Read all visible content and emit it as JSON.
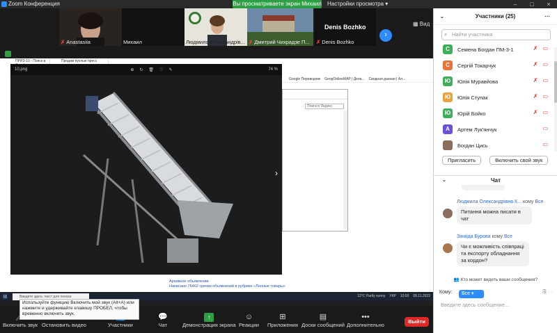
{
  "window": {
    "title": "Zoom Конференция",
    "viewing_banner": "Вы просматриваете экран Михаил",
    "view_options": "Настройки просмотра ▾"
  },
  "video_tiles": [
    {
      "name": "Anastasiia",
      "muted": true
    },
    {
      "name": "Михаил",
      "muted": false
    },
    {
      "name": "Людмила Олександрів...",
      "muted": false
    },
    {
      "name": "Дмитрий Чихрадзе П...",
      "muted": true
    },
    {
      "name": "Denis Bozhko",
      "muted": true
    }
  ],
  "denis_label": "Denis Bozhko",
  "view_button": "Вид",
  "photo_viewer": {
    "file": "10.png",
    "zoom": "74 %"
  },
  "browser": {
    "tabs": [
      "ПРИЗ-10 - Поиск в Google",
      "Продам пухлые пресс подач..."
    ],
    "bookmarks": [
      "Google Переводчик",
      "GeogOnlineMAP | Дела...",
      "Сводная данная | Ал..."
    ],
    "search_placeholder": "Поиск в Яндекс",
    "ads": [
      "Архивное объявление",
      "Написано 76462 среник объявлений в рубрике «Ленные товары»"
    ]
  },
  "taskbar": {
    "search_placeholder": "Введите здесь текст для поиска",
    "weather": "12°C Partly sunny",
    "lang": "УКР",
    "time": "10:03",
    "date": "08.11.2022"
  },
  "tooltip": "Используйте функцию Включить мой звук (Alt+A) или нажмите и удерживайте клавишу ПРОБЕЛ, чтобы временно включить звук.",
  "toolbar": {
    "unmute": "Включить звук",
    "video": "Остановить видео",
    "participants": "Участники",
    "participants_count": "25",
    "chat": "Чат",
    "share": "Демонстрация экрана",
    "reactions": "Реакции",
    "apps": "Приложения",
    "docs": "Доски сообщений",
    "more": "Дополнительно",
    "leave": "Выйти"
  },
  "participants_panel": {
    "title": "Участники (25)",
    "search_placeholder": "Найти участника",
    "list": [
      {
        "initial": "С",
        "name": "Семена Богдан ПМ-3-1",
        "color": "#3fae5a"
      },
      {
        "initial": "С",
        "name": "Сергій Токарчук",
        "color": "#e8733a"
      },
      {
        "initial": "Ю",
        "name": "Юлія Муравйова",
        "color": "#3fae5a"
      },
      {
        "initial": "Ю",
        "name": "Юлія Ступак",
        "color": "#e8a43a"
      },
      {
        "initial": "Ю",
        "name": "Юрій Бойко",
        "color": "#3fae5a"
      },
      {
        "initial": "А",
        "name": "Артем Лук'янчук",
        "color": "#6b4fd8"
      },
      {
        "initial": "",
        "name": "Богдан Цись",
        "color": "#8a6d5c"
      }
    ],
    "invite_button": "Пригласить",
    "unmute_me_button": "Включить свой звук"
  },
  "chat": {
    "title": "Чат",
    "messages": [
      {
        "sender": "Людмила Олександрівна К...",
        "to_label": "кому",
        "to": "Все",
        "text": "Питання можна писати в чат"
      },
      {
        "sender": "Зінаїда Бурова",
        "to_label": "кому",
        "to": "Все",
        "text": "Чи є можливість співпраці та експорту обладнання за кордон?"
      }
    ],
    "who_sees": "Кто может видеть ваши сообщения?",
    "to_label": "Кому:",
    "to_value": "Все",
    "input_placeholder": "Введите здесь сообщение..."
  }
}
